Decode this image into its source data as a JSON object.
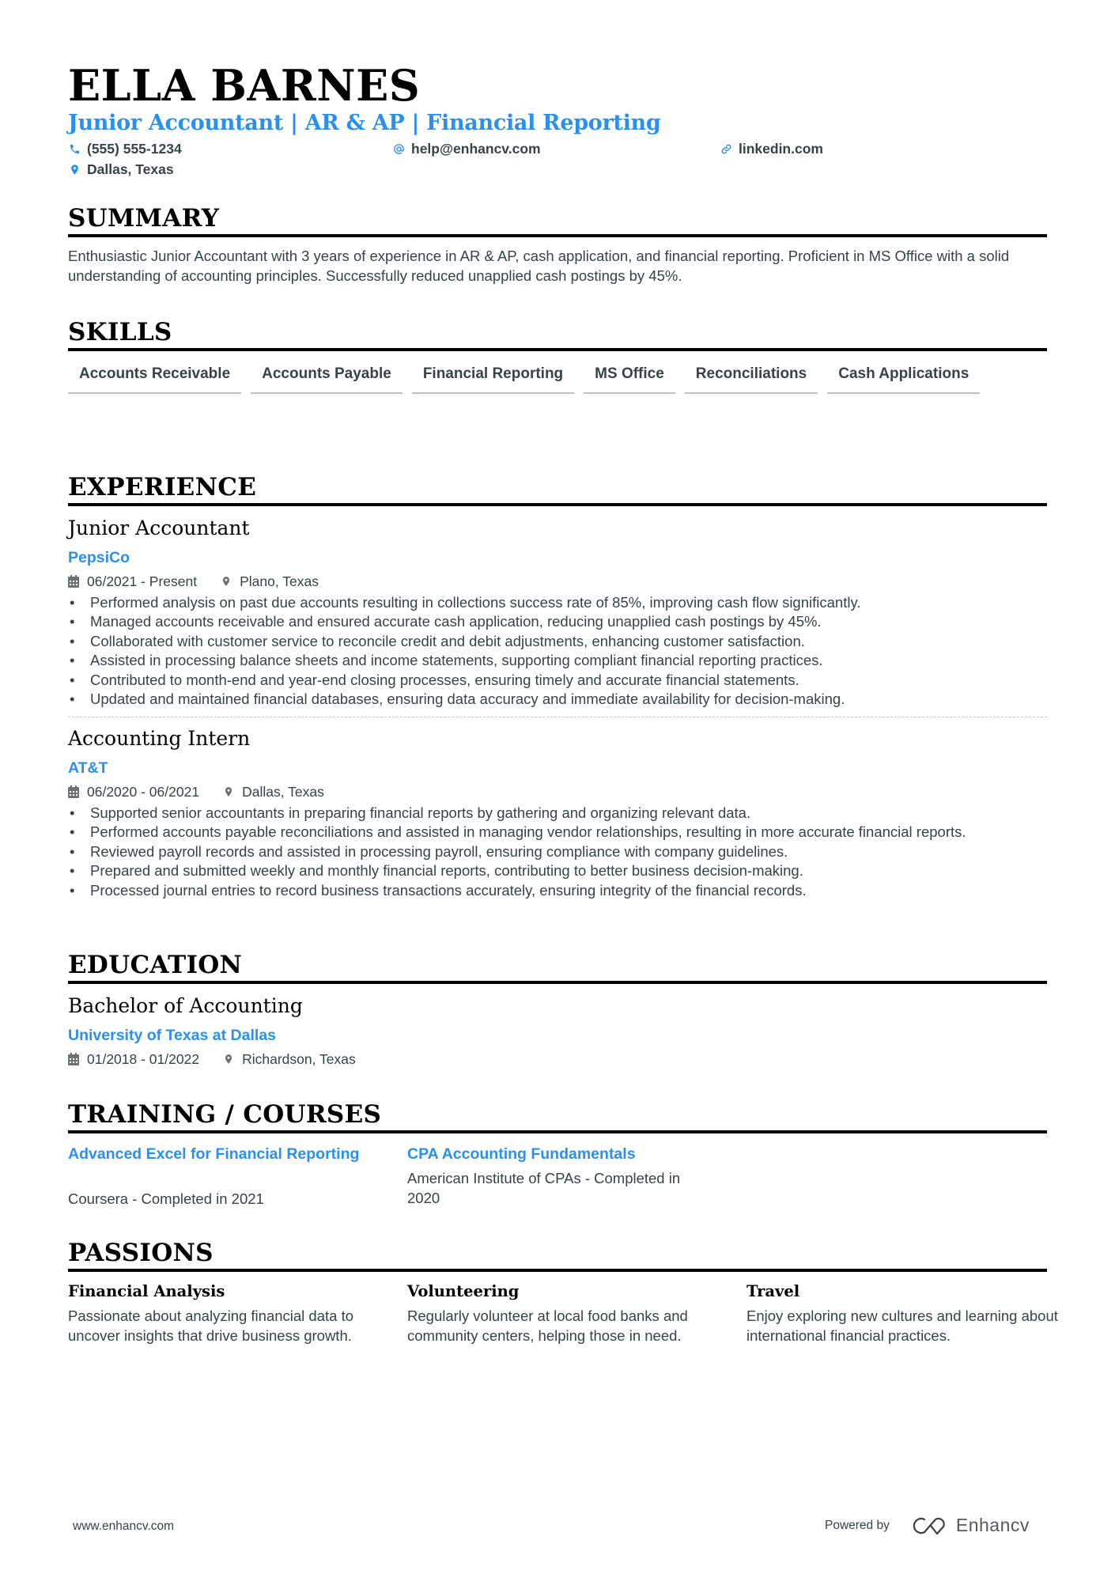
{
  "header": {
    "name": "ELLA BARNES",
    "title": "Junior Accountant | AR & AP | Financial Reporting",
    "contacts": {
      "phone": {
        "icon": "phone-icon",
        "value": "(555) 555-1234"
      },
      "email": {
        "icon": "at-icon",
        "value": "help@enhancv.com"
      },
      "link": {
        "icon": "link-icon",
        "value": "linkedin.com"
      },
      "location": {
        "icon": "location-pin-icon",
        "value": "Dallas, Texas"
      }
    }
  },
  "summary": {
    "heading": "SUMMARY",
    "text": "Enthusiastic Junior Accountant with 3 years of experience in AR & AP, cash application, and financial reporting. Proficient in MS Office with a solid understanding of accounting principles. Successfully reduced unapplied cash postings by 45%."
  },
  "skills": {
    "heading": "SKILLS",
    "items": [
      "Accounts Receivable",
      "Accounts Payable",
      "Financial Reporting",
      "MS Office",
      "Reconciliations",
      "Cash Applications"
    ]
  },
  "experience": {
    "heading": "EXPERIENCE",
    "jobs": [
      {
        "title": "Junior Accountant",
        "company": "PepsiCo",
        "dates": "06/2021 - Present",
        "location": "Plano, Texas",
        "bullets": [
          "Performed analysis on past due accounts resulting in collections success rate of 85%, improving cash flow significantly.",
          "Managed accounts receivable and ensured accurate cash application, reducing unapplied cash postings by 45%.",
          "Collaborated with customer service to reconcile credit and debit adjustments, enhancing customer satisfaction.",
          "Assisted in processing balance sheets and income statements, supporting compliant financial reporting practices.",
          "Contributed to month-end and year-end closing processes, ensuring timely and accurate financial statements.",
          "Updated and maintained financial databases, ensuring data accuracy and immediate availability for decision-making."
        ]
      },
      {
        "title": "Accounting Intern",
        "company": "AT&T",
        "dates": "06/2020 - 06/2021",
        "location": "Dallas, Texas",
        "bullets": [
          "Supported senior accountants in preparing financial reports by gathering and organizing relevant data.",
          "Performed accounts payable reconciliations and assisted in managing vendor relationships, resulting in more accurate financial reports.",
          "Reviewed payroll records and assisted in processing payroll, ensuring compliance with company guidelines.",
          "Prepared and submitted weekly and monthly financial reports, contributing to better business decision-making.",
          "Processed journal entries to record business transactions accurately, ensuring integrity of the financial records."
        ]
      }
    ]
  },
  "education": {
    "heading": "EDUCATION",
    "degree": "Bachelor of Accounting",
    "school": "University of Texas at Dallas",
    "dates": "01/2018 - 01/2022",
    "location": "Richardson, Texas"
  },
  "training": {
    "heading": "TRAINING / COURSES",
    "items": [
      {
        "title": "Advanced Excel for Financial Reporting",
        "desc": "Coursera - Completed in 2021"
      },
      {
        "title": "CPA Accounting Fundamentals",
        "desc": "American Institute of CPAs - Completed in 2020"
      }
    ]
  },
  "passions": {
    "heading": "PASSIONS",
    "items": [
      {
        "title": "Financial Analysis",
        "desc": "Passionate about analyzing financial data to uncover insights that drive business growth."
      },
      {
        "title": "Volunteering",
        "desc": "Regularly volunteer at local food banks and community centers, helping those in need."
      },
      {
        "title": "Travel",
        "desc": "Enjoy exploring new cultures and learning about international financial practices."
      }
    ]
  },
  "footer": {
    "website": "www.enhancv.com",
    "powered_by": "Powered by",
    "brand": "Enhancv"
  },
  "colors": {
    "accent": "#2a90f0",
    "text": "#384347",
    "heading": "#000000"
  }
}
